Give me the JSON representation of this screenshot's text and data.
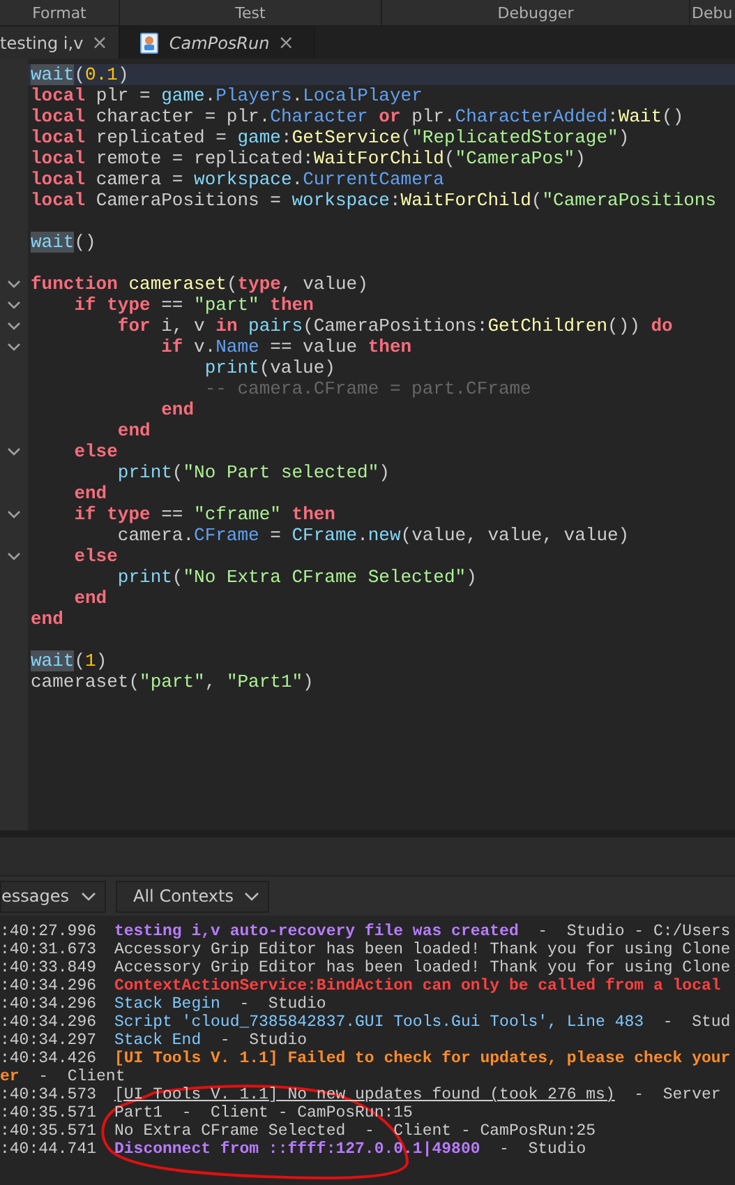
{
  "ribbon_sections": [
    "Format",
    "Test",
    "Debugger",
    "Debu"
  ],
  "tabs": [
    {
      "label": "testing i,v",
      "close": "×",
      "selected": false,
      "icon": false
    },
    {
      "label": "CamPosRun",
      "close": "×",
      "selected": true,
      "icon": true
    }
  ],
  "code_lines": [
    {
      "fold": false,
      "current": true,
      "tokens": [
        {
          "text": "wait",
          "kind": "match"
        },
        {
          "text": "(",
          "kind": "plain"
        },
        {
          "text": "0.1",
          "kind": "num"
        },
        {
          "text": ")",
          "kind": "plain"
        }
      ]
    },
    {
      "fold": false,
      "current": false,
      "tokens": [
        {
          "text": "local",
          "kind": "kw"
        },
        {
          "text": " plr = ",
          "kind": "plain"
        },
        {
          "text": "game",
          "kind": "builtin"
        },
        {
          "text": ".",
          "kind": "plain"
        },
        {
          "text": "Players",
          "kind": "prop"
        },
        {
          "text": ".",
          "kind": "plain"
        },
        {
          "text": "LocalPlayer",
          "kind": "prop"
        }
      ]
    },
    {
      "fold": false,
      "current": false,
      "tokens": [
        {
          "text": "local",
          "kind": "kw"
        },
        {
          "text": " character = plr.",
          "kind": "plain"
        },
        {
          "text": "Character",
          "kind": "prop"
        },
        {
          "text": " or",
          "kind": "kw"
        },
        {
          "text": " plr.",
          "kind": "plain"
        },
        {
          "text": "CharacterAdded",
          "kind": "prop"
        },
        {
          "text": ":",
          "kind": "plain"
        },
        {
          "text": "Wait",
          "kind": "method"
        },
        {
          "text": "()",
          "kind": "plain"
        }
      ]
    },
    {
      "fold": false,
      "current": false,
      "tokens": [
        {
          "text": "local",
          "kind": "kw"
        },
        {
          "text": " replicated = ",
          "kind": "plain"
        },
        {
          "text": "game",
          "kind": "builtin"
        },
        {
          "text": ":",
          "kind": "plain"
        },
        {
          "text": "GetService",
          "kind": "method"
        },
        {
          "text": "(",
          "kind": "plain"
        },
        {
          "text": "\"ReplicatedStorage\"",
          "kind": "str"
        },
        {
          "text": ")",
          "kind": "plain"
        }
      ]
    },
    {
      "fold": false,
      "current": false,
      "tokens": [
        {
          "text": "local",
          "kind": "kw"
        },
        {
          "text": " remote = replicated:",
          "kind": "plain"
        },
        {
          "text": "WaitForChild",
          "kind": "method"
        },
        {
          "text": "(",
          "kind": "plain"
        },
        {
          "text": "\"CameraPos\"",
          "kind": "str"
        },
        {
          "text": ")",
          "kind": "plain"
        }
      ]
    },
    {
      "fold": false,
      "current": false,
      "tokens": [
        {
          "text": "local",
          "kind": "kw"
        },
        {
          "text": " camera = ",
          "kind": "plain"
        },
        {
          "text": "workspace",
          "kind": "builtin"
        },
        {
          "text": ".",
          "kind": "plain"
        },
        {
          "text": "CurrentCamera",
          "kind": "prop"
        }
      ]
    },
    {
      "fold": false,
      "current": false,
      "tokens": [
        {
          "text": "local",
          "kind": "kw"
        },
        {
          "text": " CameraPositions = ",
          "kind": "plain"
        },
        {
          "text": "workspace",
          "kind": "builtin"
        },
        {
          "text": ":",
          "kind": "plain"
        },
        {
          "text": "WaitForChild",
          "kind": "method"
        },
        {
          "text": "(",
          "kind": "plain"
        },
        {
          "text": "\"CameraPositions",
          "kind": "str"
        }
      ]
    },
    {
      "fold": false,
      "current": false
    },
    {
      "fold": false,
      "current": false,
      "tokens": [
        {
          "text": "wait",
          "kind": "match"
        },
        {
          "text": "()",
          "kind": "plain"
        }
      ]
    },
    {
      "fold": false,
      "current": false
    },
    {
      "fold": true,
      "current": false,
      "tokens": [
        {
          "text": "function",
          "kind": "kw"
        },
        {
          "text": " cameraset",
          "kind": "method"
        },
        {
          "text": "(",
          "kind": "plain"
        },
        {
          "text": "type",
          "kind": "kw"
        },
        {
          "text": ", value)",
          "kind": "plain"
        }
      ]
    },
    {
      "fold": true,
      "current": false,
      "tokens": [
        {
          "text": "    if type",
          "kind": "kw"
        },
        {
          "text": " == ",
          "kind": "plain"
        },
        {
          "text": "\"part\"",
          "kind": "str"
        },
        {
          "text": " then",
          "kind": "kw"
        }
      ]
    },
    {
      "fold": true,
      "current": false,
      "tokens": [
        {
          "text": "        for",
          "kind": "kw"
        },
        {
          "text": " i, v ",
          "kind": "plain"
        },
        {
          "text": "in",
          "kind": "kw"
        },
        {
          "text": " pairs",
          "kind": "builtin"
        },
        {
          "text": "(CameraPositions:",
          "kind": "plain"
        },
        {
          "text": "GetChildren",
          "kind": "method"
        },
        {
          "text": "()) ",
          "kind": "plain"
        },
        {
          "text": "do",
          "kind": "kw"
        }
      ]
    },
    {
      "fold": true,
      "current": false,
      "tokens": [
        {
          "text": "            if",
          "kind": "kw"
        },
        {
          "text": " v.",
          "kind": "plain"
        },
        {
          "text": "Name",
          "kind": "prop"
        },
        {
          "text": " == value ",
          "kind": "plain"
        },
        {
          "text": "then",
          "kind": "kw"
        }
      ]
    },
    {
      "fold": false,
      "current": false,
      "tokens": [
        {
          "text": "                print",
          "kind": "builtin"
        },
        {
          "text": "(value)",
          "kind": "plain"
        }
      ]
    },
    {
      "fold": false,
      "current": false,
      "tokens": [
        {
          "text": "                -- camera.CFrame = part.CFrame",
          "kind": "comment"
        }
      ]
    },
    {
      "fold": false,
      "current": false,
      "tokens": [
        {
          "text": "            end",
          "kind": "kw"
        }
      ]
    },
    {
      "fold": false,
      "current": false,
      "tokens": [
        {
          "text": "        end",
          "kind": "kw"
        }
      ]
    },
    {
      "fold": true,
      "current": false,
      "tokens": [
        {
          "text": "    else",
          "kind": "kw"
        }
      ]
    },
    {
      "fold": false,
      "current": false,
      "tokens": [
        {
          "text": "        print",
          "kind": "builtin"
        },
        {
          "text": "(",
          "kind": "plain"
        },
        {
          "text": "\"No Part selected\"",
          "kind": "str"
        },
        {
          "text": ")",
          "kind": "plain"
        }
      ]
    },
    {
      "fold": false,
      "current": false,
      "tokens": [
        {
          "text": "    end",
          "kind": "kw"
        }
      ]
    },
    {
      "fold": true,
      "current": false,
      "tokens": [
        {
          "text": "    if type",
          "kind": "kw"
        },
        {
          "text": " == ",
          "kind": "plain"
        },
        {
          "text": "\"cframe\"",
          "kind": "str"
        },
        {
          "text": " then",
          "kind": "kw"
        }
      ]
    },
    {
      "fold": false,
      "current": false,
      "tokens": [
        {
          "text": "        camera.",
          "kind": "plain"
        },
        {
          "text": "CFrame",
          "kind": "prop"
        },
        {
          "text": " = ",
          "kind": "plain"
        },
        {
          "text": "CFrame",
          "kind": "builtin"
        },
        {
          "text": ".",
          "kind": "plain"
        },
        {
          "text": "new",
          "kind": "builtin"
        },
        {
          "text": "(value, value, value)",
          "kind": "plain"
        }
      ]
    },
    {
      "fold": true,
      "current": false,
      "tokens": [
        {
          "text": "    else",
          "kind": "kw"
        }
      ]
    },
    {
      "fold": false,
      "current": false,
      "tokens": [
        {
          "text": "        print",
          "kind": "builtin"
        },
        {
          "text": "(",
          "kind": "plain"
        },
        {
          "text": "\"No Extra CFrame Selected\"",
          "kind": "str"
        },
        {
          "text": ")",
          "kind": "plain"
        }
      ]
    },
    {
      "fold": false,
      "current": false,
      "tokens": [
        {
          "text": "    end",
          "kind": "kw"
        }
      ]
    },
    {
      "fold": false,
      "current": false,
      "tokens": [
        {
          "text": "end",
          "kind": "kw"
        }
      ]
    },
    {
      "fold": false,
      "current": false
    },
    {
      "fold": false,
      "current": false,
      "tokens": [
        {
          "text": "wait",
          "kind": "match"
        },
        {
          "text": "(",
          "kind": "plain"
        },
        {
          "text": "1",
          "kind": "num"
        },
        {
          "text": ")",
          "kind": "plain"
        }
      ]
    },
    {
      "fold": false,
      "current": false,
      "tokens": [
        {
          "text": "cameraset(",
          "kind": "plain"
        },
        {
          "text": "\"part\"",
          "kind": "str"
        },
        {
          "text": ", ",
          "kind": "plain"
        },
        {
          "text": "\"Part1\"",
          "kind": "str"
        },
        {
          "text": ")",
          "kind": "plain"
        }
      ]
    }
  ],
  "output": {
    "filters": [
      "essages",
      "All Contexts"
    ],
    "rows": [
      {
        "time": ":40:27.996",
        "message": "testing i,v auto-recovery file was created",
        "source": "-  Studio - C:/Users",
        "kind": "info"
      },
      {
        "time": ":40:31.673",
        "message": "Accessory Grip Editor has been loaded! Thank you for using Clone",
        "kind": "print"
      },
      {
        "time": ":40:33.849",
        "message": "Accessory Grip Editor has been loaded! Thank you for using Clone",
        "kind": "print"
      },
      {
        "time": ":40:34.296",
        "message": "ContextActionService:BindAction can only be called from a local",
        "kind": "error"
      },
      {
        "time": ":40:34.296",
        "message": "Stack Begin",
        "source": "-  Studio",
        "kind": "stack"
      },
      {
        "time": ":40:34.296",
        "message": "Script 'cloud_7385842837.GUI Tools.Gui Tools', Line 483",
        "source": "-  Stud",
        "kind": "stack"
      },
      {
        "time": ":40:34.297",
        "message": "Stack End",
        "source": "-  Studio",
        "kind": "stack"
      },
      {
        "time": ":40:34.426",
        "message": "[UI Tools V. 1.1] Failed to check for updates, please check your",
        "kind": "warning"
      },
      {
        "message": "er",
        "source": "-  Client",
        "kind": "warning"
      },
      {
        "time": ":40:34.573",
        "message": "[UI Tools V. 1.1] No new updates found (took 276 ms)",
        "source": "-  Server",
        "kind": "link"
      },
      {
        "time": ":40:35.571",
        "message": "Part1",
        "source": "-  Client - CamPosRun:15",
        "kind": "print"
      },
      {
        "time": ":40:35.571",
        "message": "No Extra CFrame Selected",
        "source": "-  Client - CamPosRun:25",
        "kind": "print"
      },
      {
        "time": ":40:44.741",
        "message": "Disconnect from ::ffff:127.0.0.1|49800",
        "source": "-  Studio",
        "kind": "info"
      }
    ]
  }
}
